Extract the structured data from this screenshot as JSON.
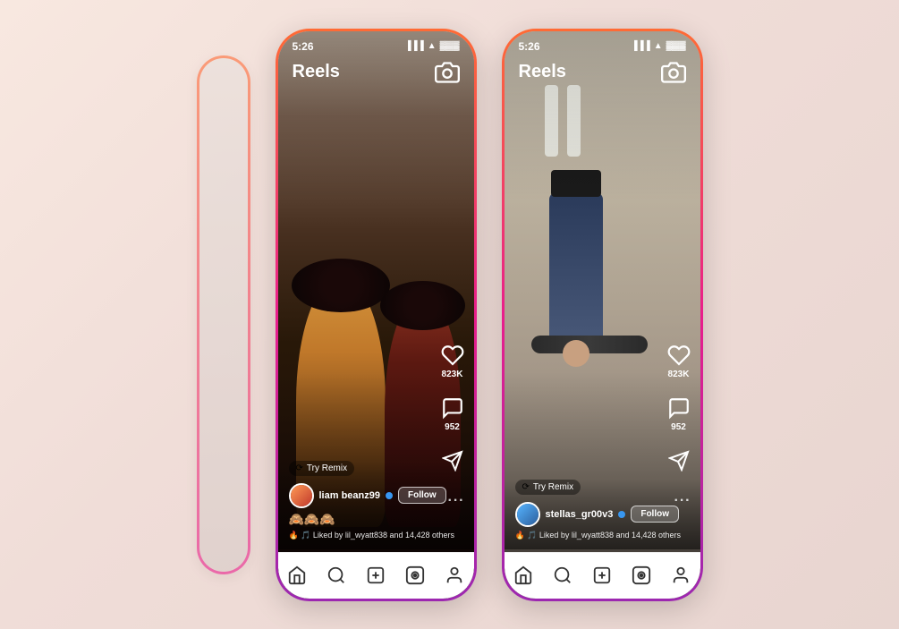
{
  "background": "#f0e0d8",
  "phone1": {
    "status_time": "5:26",
    "title": "Reels",
    "like_count": "823K",
    "comment_count": "952",
    "try_remix": "Try Remix",
    "username": "liam beanz99",
    "follow_label": "Follow",
    "caption": "🙈🙈🙈",
    "likes_text": "🔥 🎵 Liked by lil_wyatt838 and 14,428 others",
    "nav_items": [
      "home",
      "search",
      "add",
      "reels",
      "profile"
    ]
  },
  "phone2": {
    "status_time": "5:26",
    "title": "Reels",
    "like_count": "823K",
    "comment_count": "952",
    "try_remix": "Try Remix",
    "username": "stellas_gr00v3",
    "follow_label": "Follow",
    "likes_text": "🔥 🎵 Liked by lil_wyatt838 and 14,428 others",
    "nav_items": [
      "home",
      "search",
      "add",
      "reels",
      "profile"
    ]
  }
}
